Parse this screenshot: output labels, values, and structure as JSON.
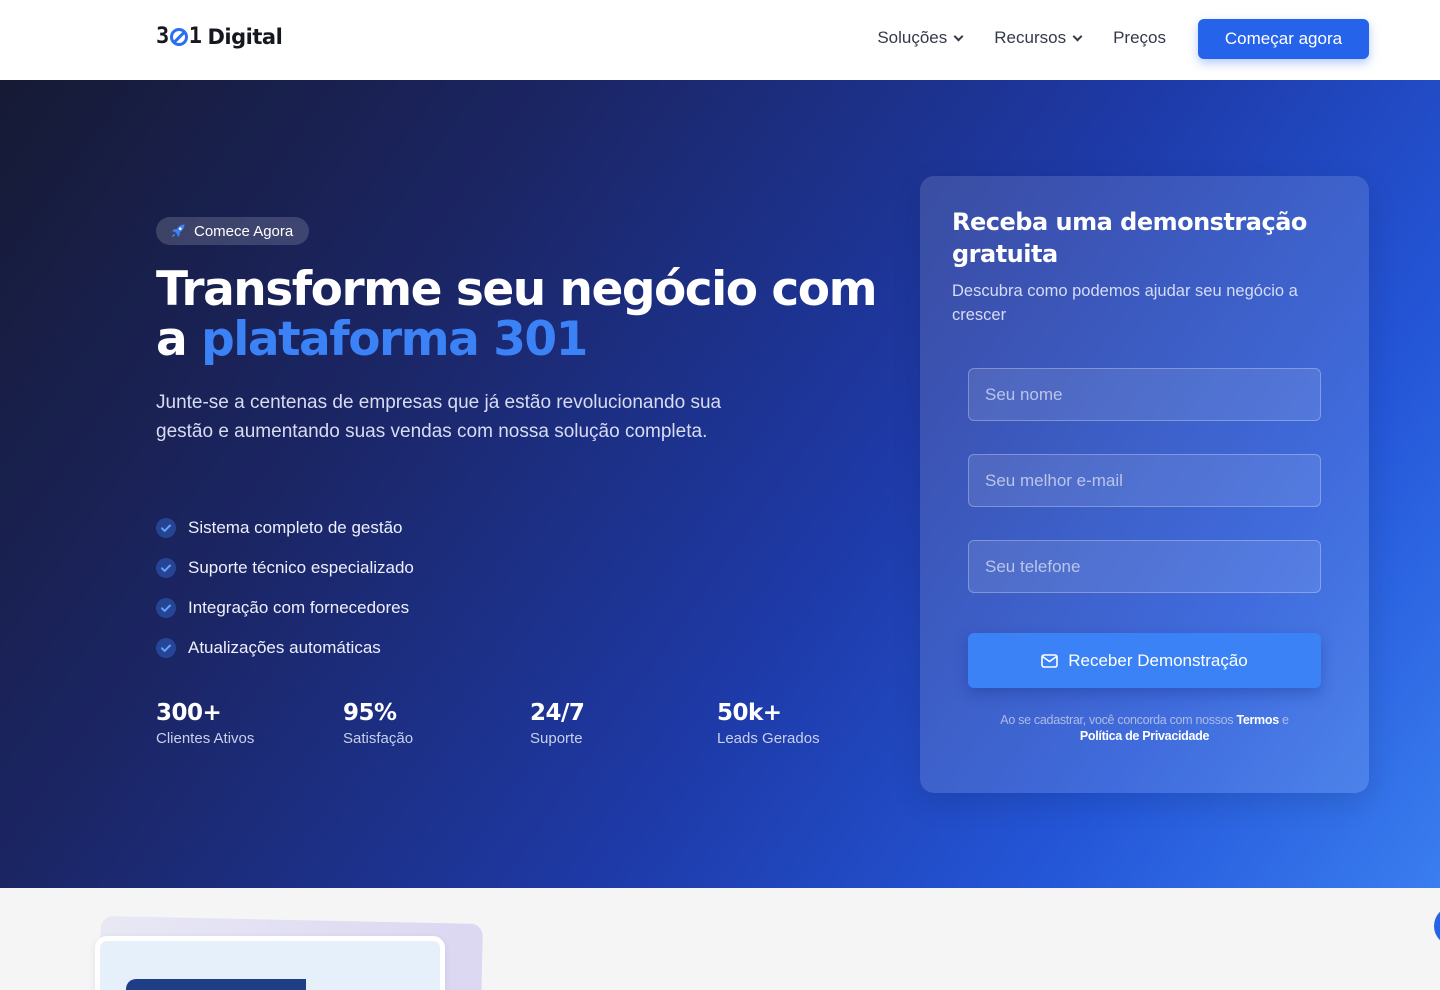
{
  "brand": {
    "prefix": "3",
    "suffix": "1",
    "name": "Digital",
    "accent": "#2b6ef2"
  },
  "nav": {
    "items": [
      {
        "label": "Soluções",
        "has_dropdown": true
      },
      {
        "label": "Recursos",
        "has_dropdown": true
      },
      {
        "label": "Preços",
        "has_dropdown": false
      }
    ],
    "cta_label": "Começar agora"
  },
  "hero": {
    "badge": "Comece Agora",
    "headline_part1": "Transforme seu negócio com a ",
    "headline_highlight": "plataforma 301",
    "subtitle": "Junte-se a centenas de empresas que já estão revolucionando sua gestão e aumentando suas vendas com nossa solução completa.",
    "features": [
      "Sistema completo de gestão",
      "Suporte técnico especializado",
      "Integração com fornecedores",
      "Atualizações automáticas"
    ],
    "stats": [
      {
        "value": "300+",
        "label": "Clientes Ativos"
      },
      {
        "value": "95%",
        "label": "Satisfação"
      },
      {
        "value": "24/7",
        "label": "Suporte"
      },
      {
        "value": "50k+",
        "label": "Leads Gerados"
      }
    ]
  },
  "form": {
    "title": "Receba uma demonstração gratuita",
    "description": "Descubra como podemos ajudar seu negócio a crescer",
    "name_placeholder": "Seu nome",
    "email_placeholder": "Seu melhor e-mail",
    "phone_placeholder": "Seu telefone",
    "submit_label": "Receber Demonstração",
    "terms_prefix": "Ao se cadastrar, você concorda com nossos ",
    "terms_link": "Termos",
    "terms_and": " e ",
    "privacy_link": "Política de Privacidade"
  },
  "colors": {
    "primary": "#2563eb",
    "highlight": "#3b82f6",
    "hero_dark": "#161a34"
  }
}
